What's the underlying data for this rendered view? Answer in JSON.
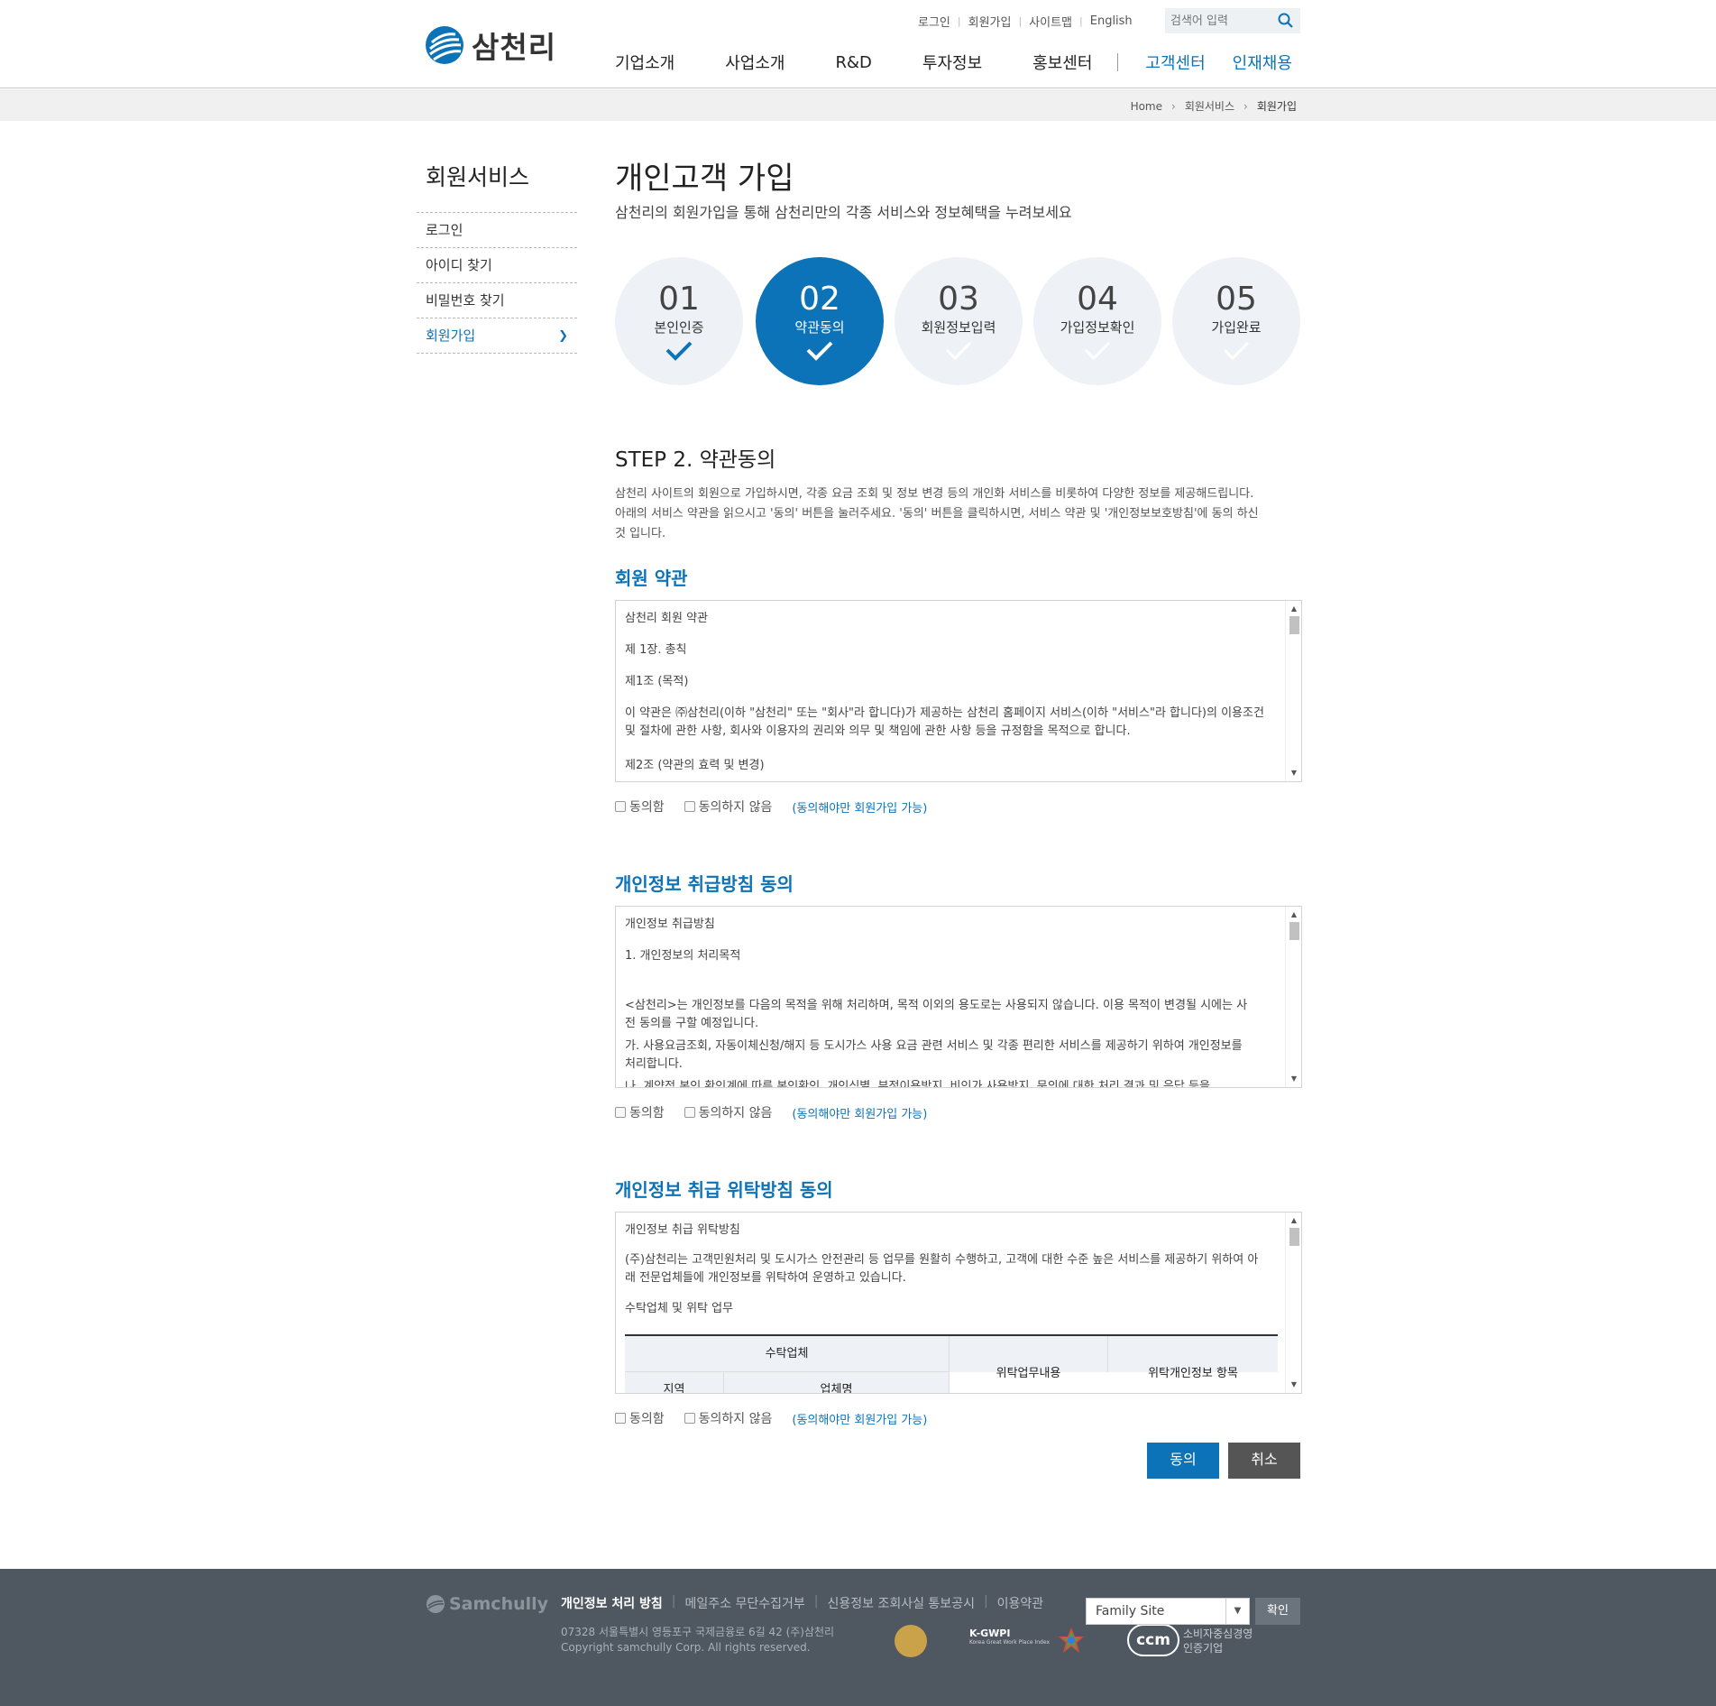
{
  "header": {
    "logo_text": "삼천리",
    "util_links": [
      "로그인",
      "회원가입",
      "사이트맵",
      "English"
    ],
    "search_placeholder": "검색어 입력",
    "gnb": [
      "기업소개",
      "사업소개",
      "R&D",
      "투자정보",
      "홍보센터"
    ],
    "gnb_right": [
      "고객센터",
      "인재채용"
    ]
  },
  "breadcrumb": [
    "Home",
    "회원서비스",
    "회원가입"
  ],
  "sidebar": {
    "title": "회원서비스",
    "items": [
      {
        "label": "로그인"
      },
      {
        "label": "아이디 찾기"
      },
      {
        "label": "비밀번호 찾기"
      },
      {
        "label": "회원가입",
        "active": true
      }
    ]
  },
  "main": {
    "title": "개인고객 가입",
    "subtitle": "삼천리의 회원가입을 통해 삼천리만의 각종 서비스와 정보혜택을 누려보세요",
    "steps": [
      {
        "num": "01",
        "label": "본인인증",
        "state": "done"
      },
      {
        "num": "02",
        "label": "약관동의",
        "state": "active"
      },
      {
        "num": "03",
        "label": "회원정보입력",
        "state": "todo"
      },
      {
        "num": "04",
        "label": "가입정보확인",
        "state": "todo"
      },
      {
        "num": "05",
        "label": "가입완료",
        "state": "todo"
      }
    ],
    "step_heading": "STEP 2. 약관동의",
    "step_desc": "삼천리 사이트의 회원으로 가입하시면, 각종 요금 조회 및 정보 변경 등의 개인화 서비스를 비롯하여 다양한 정보를 제공해드립니다. 아래의 서비스 약관을 읽으시고 '동의' 버튼을 눌러주세요. '동의' 버튼을 클릭하시면, 서비스 약관 및 '개인정보보호방침'에 동의 하신것 입니다.",
    "agree_label": "동의함",
    "disagree_label": "동의하지 않음",
    "agree_note": "(동의해야만 회원가입 가능)",
    "sections": [
      {
        "title": "회원 약관",
        "paragraphs": [
          "삼천리 회원 약관",
          "제 1장. 총칙",
          "제1조 (목적)",
          "이 약관은 ㈜삼천리(이하 \"삼천리\" 또는 \"회사\"라 합니다)가 제공하는 삼천리 홈페이지 서비스(이하 \"서비스\"라 합니다)의 이용조건 및 절차에 관한 사항, 회사와 이용자의 권리와 의무 및 책임에 관한 사항 등을 규정함을 목적으로 합니다.",
          "제2조 (약관의 효력 및 변경)"
        ]
      },
      {
        "title": "개인정보 취급방침 동의",
        "paragraphs": [
          "개인정보 취급방침",
          "1. 개인정보의 처리목적",
          "",
          "<삼천리>는 개인정보를 다음의 목적을 위해 처리하며, 목적 이외의 용도로는 사용되지 않습니다. 이용 목적이 변경될 시에는 사전 동의를 구할 예정입니다.",
          "가. 사용요금조회, 자동이체신청/해지 등 도시가스 사용 요금 관련 서비스 및 각종 편리한 서비스를 제공하기 위하여 개인정보를 처리합니다.",
          "나. 계약적 본인 확인계에 따른 본인확인, 개인식별, 부정이용방지, 비인가 사용방지, 문의에 대한 처리 결과 및 응답 등을"
        ]
      },
      {
        "title": "개인정보 취급 위탁방침 동의",
        "paragraphs": [
          "개인정보 취급 위탁방침",
          "(주)삼천리는 고객민원처리 및 도시가스 안전관리 등 업무를 원활히 수행하고, 고객에 대한 수준 높은 서비스를 제공하기 위하여 아래 전문업체들에 개인정보를 위탁하여 운영하고 있습니다.",
          "수탁업체 및 위탁 업무"
        ],
        "table_headers": {
          "group": "수탁업체",
          "sub": [
            "지역",
            "업체명"
          ],
          "cols": [
            "위탁업무내용",
            "위탁개인정보 항목"
          ]
        }
      }
    ],
    "btn_agree": "동의",
    "btn_cancel": "취소"
  },
  "footer": {
    "logo": "Samchully",
    "links": [
      "개인정보 처리 방침",
      "메일주소 무단수집거부",
      "신용정보 조회사실 통보공시",
      "이용약관"
    ],
    "address": "07328 서울특별시 영등포구 국제금융로 6길 42 (주)삼천리",
    "copyright": "Copyright samchully Corp. All rights reserved.",
    "family_site": "Family Site",
    "confirm": "확인",
    "kgwpi": "K-GWPI",
    "kgwpi_sub": "Korea Great Work Place Index",
    "ccm": "ccm",
    "ccm_text": "소비자중심경영\n인증기업"
  }
}
